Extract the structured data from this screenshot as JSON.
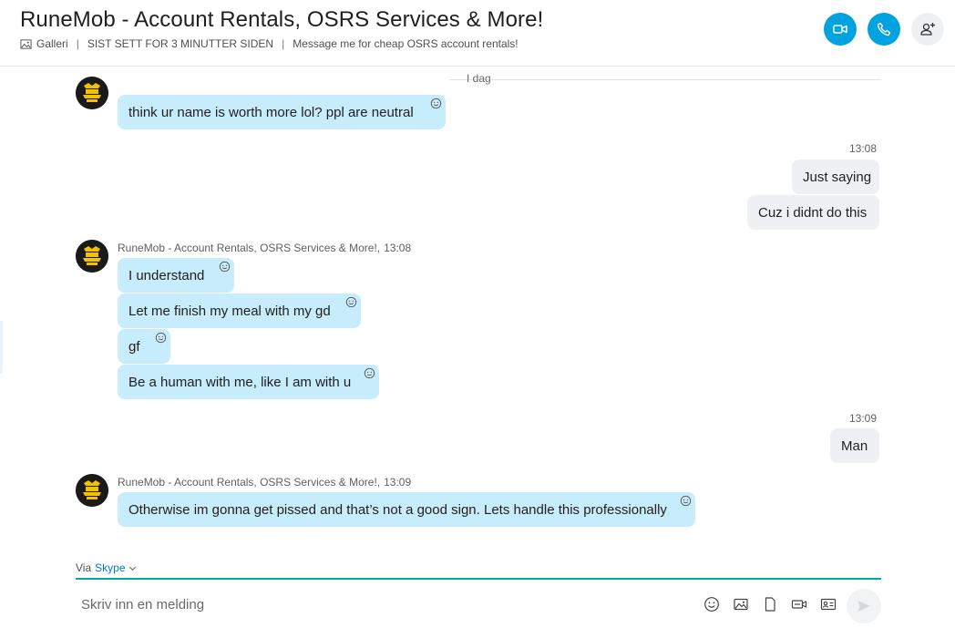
{
  "header": {
    "title": "RuneMob - Account Rentals, OSRS Services & More!",
    "gallery_label": "Galleri",
    "separator": "|",
    "last_seen": "SIST SETT FOR 3 MINUTTER SIDEN",
    "mood": "Message me for cheap OSRS account rentals!",
    "icons": {
      "video": "video-call-icon",
      "call": "audio-call-icon",
      "add": "add-person-icon"
    },
    "accent": "#00a2e0"
  },
  "day_divider": "I dag",
  "messages": {
    "m1": "think ur name is worth more lol? ppl are neutral",
    "t1": "13:08",
    "o1": "Just saying",
    "o2": "Cuz i didnt do this",
    "sender": "RuneMob - Account Rentals, OSRS Services & More!,",
    "t2": "13:08",
    "m2": "I understand",
    "m3": "Let me finish my meal with my gd",
    "m4": "gf",
    "m5": "Be a human with me, like I am with u",
    "t3": "13:09",
    "o3": "Man",
    "t4": "13:09",
    "m6": "Otherwise im gonna get pissed and that’s not a good sign. Lets handle this professionally"
  },
  "composer": {
    "via": "Via",
    "via_app": "Skype",
    "placeholder": "Skriv inn en melding",
    "tools": [
      "emoji-icon",
      "image-icon",
      "file-icon",
      "video-message-icon",
      "contact-card-icon"
    ],
    "send": "send-icon"
  },
  "colors": {
    "incoming_bubble": "#c7ecfb",
    "outgoing_bubble": "#eef0f3",
    "composer_line": "#00a8a8"
  }
}
